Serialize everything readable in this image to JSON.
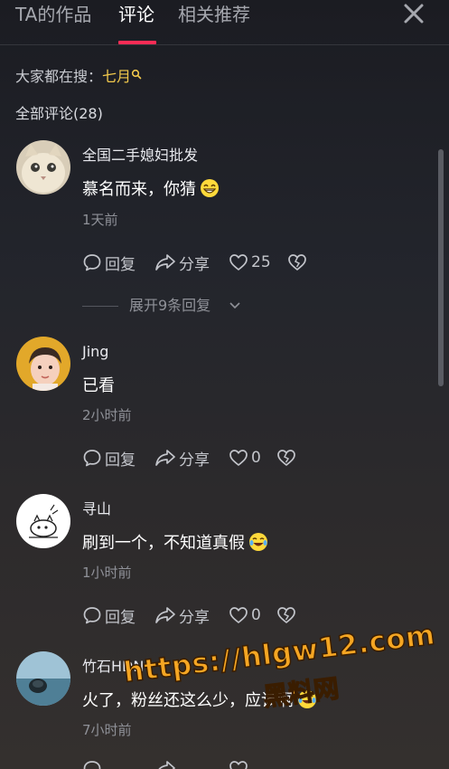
{
  "tabs": [
    {
      "label": "TA的作品",
      "active": false
    },
    {
      "label": "评论",
      "active": true
    },
    {
      "label": "相关推荐",
      "active": false
    }
  ],
  "close_icon": "close-icon",
  "hot_search": {
    "prefix": "大家都在搜：",
    "term": "七月",
    "icon": "search-icon"
  },
  "comment_count_label": "全部评论(28)",
  "action_labels": {
    "reply": "回复",
    "share": "分享"
  },
  "comments": [
    {
      "username": "全国二手媳妇批发",
      "text": "慕名而来，你猜",
      "emoji": "grin-emoji",
      "time": "1天前",
      "likes": "25",
      "expand_label": "展开9条回复"
    },
    {
      "username": "Jing",
      "text": "已看",
      "emoji": "",
      "time": "2小时前",
      "likes": "0"
    },
    {
      "username": "寻山",
      "text": "刷到一个，不知道真假",
      "emoji": "tears-of-joy-emoji",
      "time": "1小时前",
      "likes": "0"
    },
    {
      "username": "竹石HDN",
      "text": "火了，粉丝还这么少，应该啊",
      "emoji": "tears-of-joy-emoji",
      "time": "7小时前",
      "likes": ""
    }
  ],
  "watermark": {
    "url": "https://hlgw12.com",
    "name": "黑料网"
  },
  "colors": {
    "accent": "#fe2c55",
    "hot_term": "#f2c94c",
    "watermark": "#f5a623"
  }
}
